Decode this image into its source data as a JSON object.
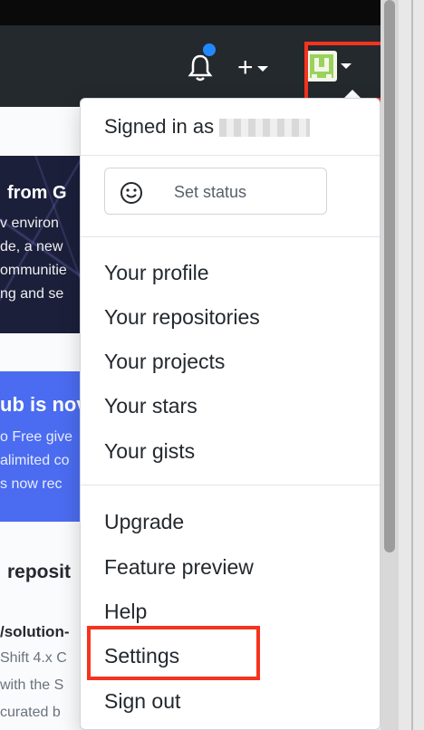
{
  "header": {
    "add_symbol": "+"
  },
  "background": {
    "hero_title": "from G",
    "hero_lines": [
      "v environ",
      "de, a new",
      "ommunitie",
      "ng and se"
    ],
    "promo_title": "ub is nov",
    "promo_lines": [
      "o Free give",
      "alimited co",
      "s now rec"
    ],
    "repo_heading": "reposit",
    "repo_name": "/solution-",
    "repo_lines": [
      "Shift 4.x C",
      "with the S",
      "curated b"
    ]
  },
  "menu": {
    "signed_in_prefix": "Signed in as",
    "set_status_label": "Set status",
    "items_group1": [
      "Your profile",
      "Your repositories",
      "Your projects",
      "Your stars",
      "Your gists"
    ],
    "items_group2": [
      "Upgrade",
      "Feature preview",
      "Help",
      "Settings",
      "Sign out"
    ]
  },
  "colors": {
    "header_bg": "#24292e",
    "highlight": "#f5331f",
    "notification_dot": "#2188ff",
    "promo_bg": "#4b6cf0"
  },
  "icons": {
    "bell": "bell-icon",
    "smile": "smiley-icon",
    "avatar": "user-avatar"
  }
}
